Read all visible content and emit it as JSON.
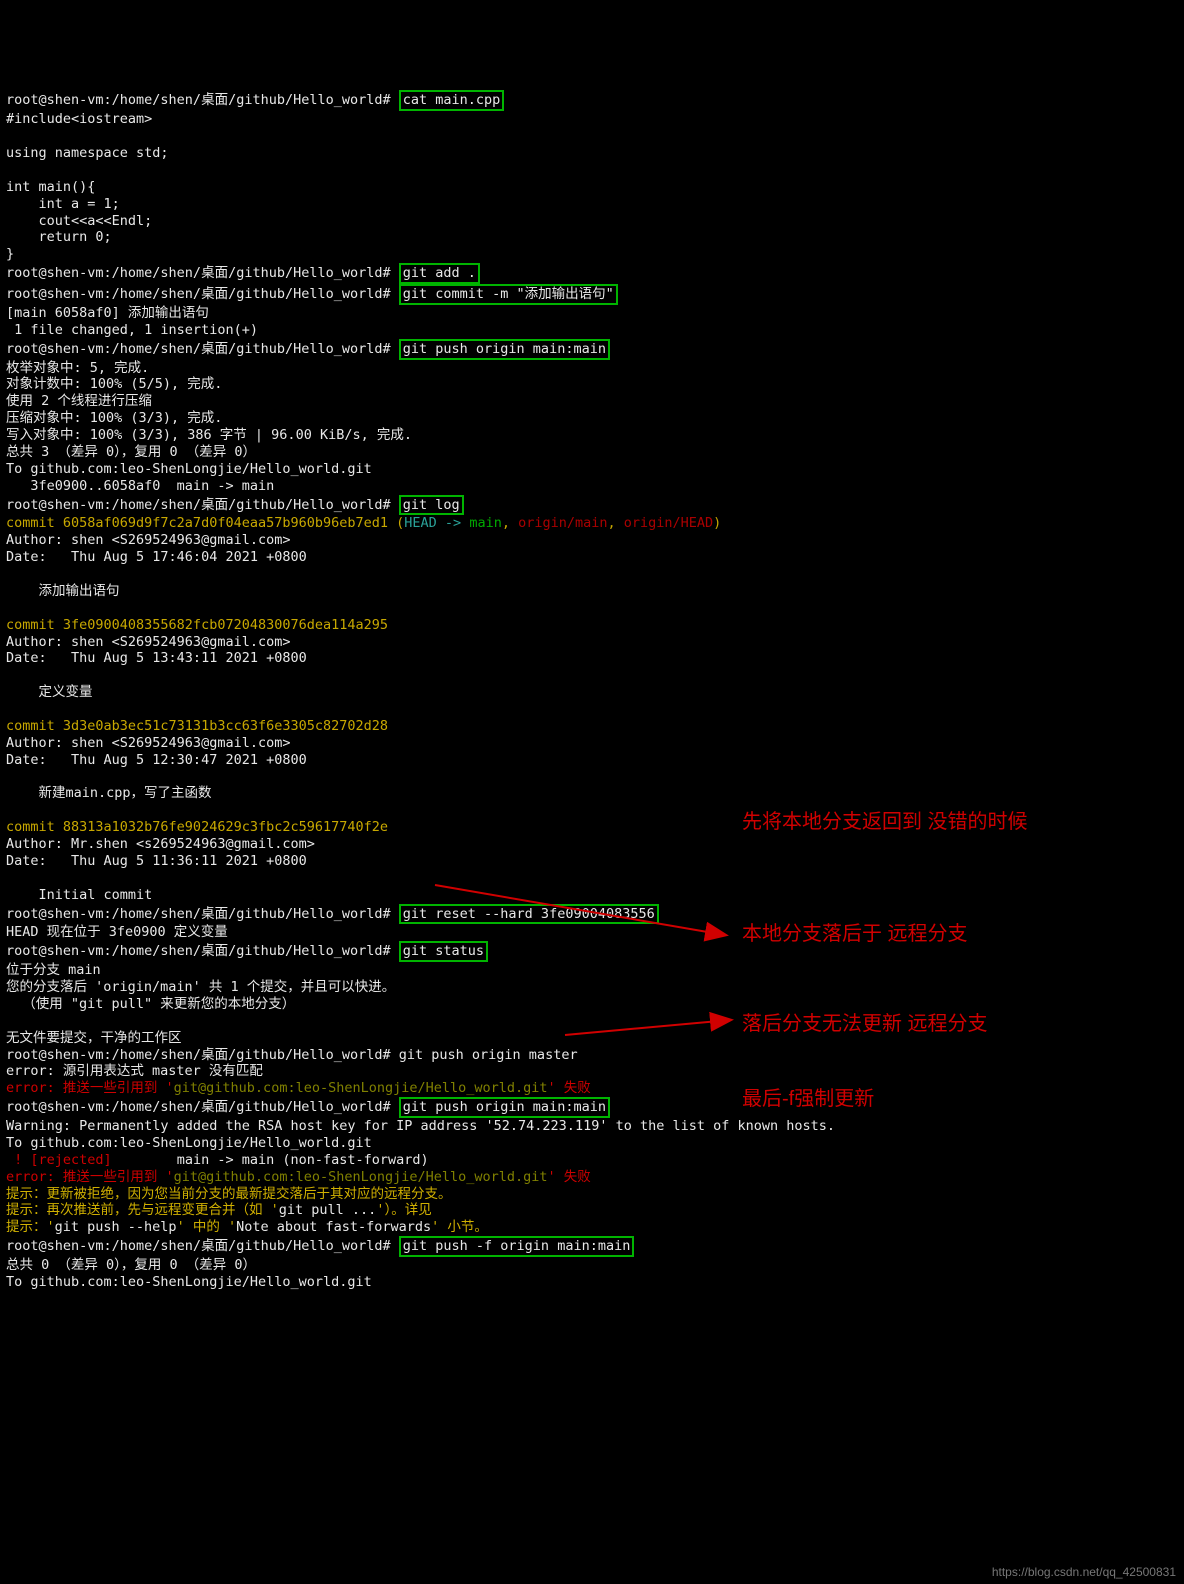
{
  "prompt": "root@shen-vm:/home/shen/桌面/github/Hello_world#",
  "cmd_cat": "cat main.cpp",
  "src": {
    "l1": "#include<iostream>",
    "l2": "",
    "l3": "using namespace std;",
    "l4": "",
    "l5": "int main(){",
    "l6": "    int a = 1;",
    "l7": "    cout<<a<<Endl;",
    "l8": "    return 0;",
    "l9": "}"
  },
  "cmd_add": "git add .",
  "cmd_commit": "git commit -m \"添加输出语句\"",
  "commit_out1": "[main 6058af0] 添加输出语句",
  "commit_out2": " 1 file changed, 1 insertion(+)",
  "cmd_push1": "git push origin main:main",
  "push": {
    "l1": "枚举对象中: 5, 完成.",
    "l2": "对象计数中: 100% (5/5), 完成.",
    "l3": "使用 2 个线程进行压缩",
    "l4": "压缩对象中: 100% (3/3), 完成.",
    "l5": "写入对象中: 100% (3/3), 386 字节 | 96.00 KiB/s, 完成.",
    "l6": "总共 3 （差异 0），复用 0 （差异 0）",
    "l7": "To github.com:leo-ShenLongjie/Hello_world.git",
    "l8": "   3fe0900..6058af0  main -> main"
  },
  "cmd_log": "git log",
  "log": {
    "c1_hash": "commit 6058af069d9f7c2a7d0f04eaa57b960b96eb7ed1",
    "c1_head_open": " (",
    "c1_head_ref": "HEAD -> ",
    "c1_head_branch": "main",
    "c1_head_sep": ", ",
    "c1_head_origin": "origin/main",
    "c1_head_sep2": ", ",
    "c1_head_originhead": "origin/HEAD",
    "c1_head_close": ")",
    "c1_author": "Author: shen <S269524963@gmail.com>",
    "c1_date": "Date:   Thu Aug 5 17:46:04 2021 +0800",
    "c1_msg": "    添加输出语句",
    "c2_hash": "commit 3fe0900408355682fcb07204830076dea114a295",
    "c2_author": "Author: shen <S269524963@gmail.com>",
    "c2_date": "Date:   Thu Aug 5 13:43:11 2021 +0800",
    "c2_msg": "    定义变量",
    "c3_hash": "commit 3d3e0ab3ec51c73131b3cc63f6e3305c82702d28",
    "c3_author": "Author: shen <S269524963@gmail.com>",
    "c3_date": "Date:   Thu Aug 5 12:30:47 2021 +0800",
    "c3_msg": "    新建main.cpp，写了主函数",
    "c4_hash": "commit 88313a1032b76fe9024629c3fbc2c59617740f2e",
    "c4_author": "Author: Mr.shen <s269524963@gmail.com>",
    "c4_date": "Date:   Thu Aug 5 11:36:11 2021 +0800",
    "c4_msg": "    Initial commit"
  },
  "cmd_reset": "git reset --hard 3fe09004083556",
  "reset_out": "HEAD 现在位于 3fe0900 定义变量",
  "cmd_status": "git status",
  "status": {
    "l1": "位于分支 main",
    "l2": "您的分支落后 'origin/main' 共 1 个提交，并且可以快进。",
    "l3": "  （使用 \"git pull\" 来更新您的本地分支）",
    "l4": "",
    "l5": "无文件要提交，干净的工作区"
  },
  "cmd_push_master": "git push origin master",
  "push_master": {
    "l1": "error: 源引用表达式 master 没有匹配",
    "l2a": "error: 推送一些引用到 '",
    "l2b": "git@github.com:leo-ShenLongjie/Hello_world.git",
    "l2c": "' 失败"
  },
  "cmd_push2": "git push origin main:main",
  "push2": {
    "w": "Warning: Permanently added the RSA host key for IP address '52.74.223.119' to the list of known hosts.",
    "to": "To github.com:leo-ShenLongjie/Hello_world.git",
    "rej_a": " ! [rejected]       ",
    "rej_b": " main -> main (non-fast-forward)",
    "err_a": "error: 推送一些引用到 '",
    "err_b": "git@github.com:leo-ShenLongjie/Hello_world.git",
    "err_c": "' 失败",
    "h1": "提示：更新被拒绝，因为您当前分支的最新提交落后于其对应的远程分支。",
    "h2a": "提示：再次推送前，先与远程变更合并（如 '",
    "h2b": "git pull ...",
    "h2c": "'）。详见",
    "h3a": "提示：'",
    "h3b": "git push --help",
    "h3c": "' 中的 '",
    "h3d": "Note about fast-forwards",
    "h3e": "' 小节。"
  },
  "cmd_pushf": "git push -f origin main:main",
  "pushf": {
    "l1": "总共 0 （差异 0），复用 0 （差异 0）",
    "l2": "To github.com:leo-ShenLongjie/Hello_world.git"
  },
  "annot": {
    "a1": "先将本地分支返回到\n没错的时候",
    "a2": "本地分支落后于\n远程分支",
    "a3": "落后分支无法更新\n远程分支",
    "a4": "最后-f强制更新"
  },
  "watermark": "https://blog.csdn.net/qq_42500831"
}
